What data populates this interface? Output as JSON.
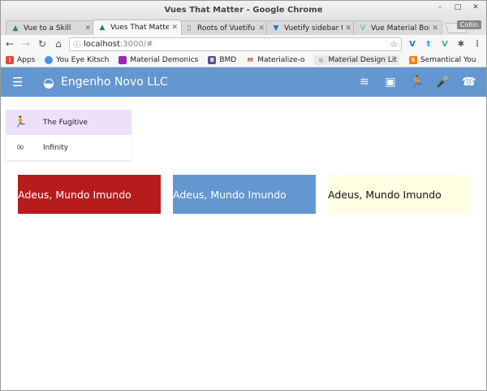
{
  "window": {
    "title": "Vues That Matter - Google Chrome",
    "controls": [
      "–",
      "□",
      "✕"
    ]
  },
  "tabs": [
    {
      "label": "Vue to a Skill",
      "active": false,
      "icon": "vuetify-icon"
    },
    {
      "label": "Vues That Matter",
      "active": true,
      "icon": "vuetify-icon"
    },
    {
      "label": "Roots of Vuetifu",
      "active": false,
      "icon": "page-icon"
    },
    {
      "label": "Vuetify sidebar tу",
      "active": false,
      "icon": "vuetify-blue-icon"
    },
    {
      "label": "Vue Material Boil",
      "active": false,
      "icon": "vue-icon"
    }
  ],
  "profile": "Collin",
  "address": {
    "host": "localhost",
    "path": ":3000/#"
  },
  "bookmarks": [
    {
      "label": "Apps",
      "icon": "apps-icon",
      "color": "#e0483e"
    },
    {
      "label": "You Eye Kitsch",
      "icon": "circle-icon",
      "color": "#4a90e2"
    },
    {
      "label": "Material Demonics",
      "icon": "square-icon",
      "color": "#9c27b0"
    },
    {
      "label": "BMD",
      "icon": "b-icon",
      "color": "#5c4a8a"
    },
    {
      "label": "Materialize-o",
      "icon": "m-icon",
      "color": "#e53935"
    },
    {
      "label": "Material Design Lit",
      "icon": "globe-icon",
      "color": "#666666"
    },
    {
      "label": "Semantical You",
      "icon": "s-icon",
      "color": "#f57c00"
    }
  ],
  "bookmarks_more": "»",
  "appbar": {
    "brand": "Engenho Novo LLC",
    "color": "#6497cf"
  },
  "nav": [
    {
      "label": "The Fugitive",
      "icon": "run-icon",
      "glyph": "🏃",
      "active": true
    },
    {
      "label": "Infinity",
      "icon": "infinity-icon",
      "glyph": "∞",
      "active": false
    }
  ],
  "cards": [
    {
      "text": "Adeus, Mundo Imundo",
      "color": "#b71c1c"
    },
    {
      "text": "Adeus, Mundo Imundo",
      "color": "#6497cf"
    },
    {
      "text": "Adeus, Mundo Imundo",
      "color": "#fffde2"
    }
  ]
}
